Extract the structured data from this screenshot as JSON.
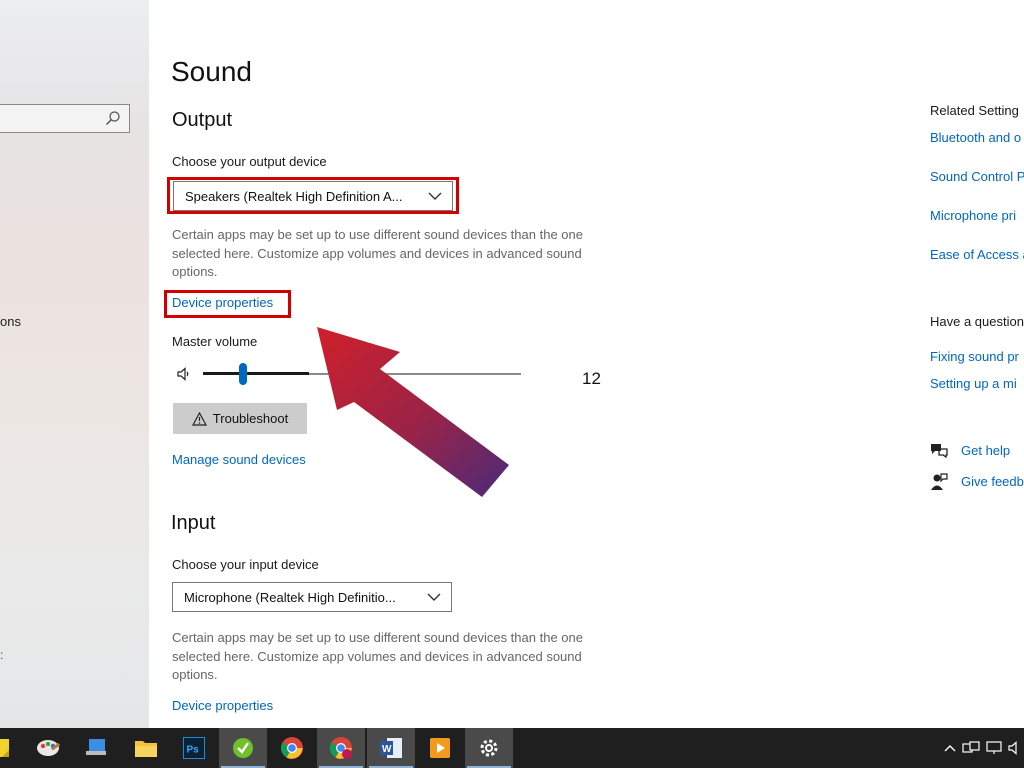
{
  "sidebar": {
    "fragment_1": "ons",
    "fragment_2": ":"
  },
  "page": {
    "title": "Sound"
  },
  "output": {
    "section_title": "Output",
    "device_label": "Choose your output device",
    "device_value": "Speakers (Realtek High Definition A...",
    "help_text": "Certain apps may be set up to use different sound devices than the one selected here. Customize app volumes and devices in advanced sound options.",
    "device_properties_link": "Device properties",
    "master_volume_label": "Master volume",
    "volume_value": "12",
    "volume_level": 12,
    "troubleshoot_label": "Troubleshoot",
    "manage_devices_link": "Manage sound devices"
  },
  "input": {
    "section_title": "Input",
    "device_label": "Choose your input device",
    "device_value": "Microphone (Realtek High Definitio...",
    "help_text": "Certain apps may be set up to use different sound devices than the one selected here. Customize app volumes and devices in advanced sound options.",
    "device_properties_link": "Device properties"
  },
  "related": {
    "heading": "Related Setting",
    "links": [
      "Bluetooth and o",
      "Sound Control P",
      "Microphone pri",
      "Ease of Access a"
    ],
    "question_heading": "Have a question",
    "question_links": [
      "Fixing sound pr",
      "Setting up a mi"
    ],
    "get_help": "Get help",
    "give_feedback": "Give feedba"
  },
  "annotation": {
    "highlight_color": "#d40000",
    "arrow_colors": [
      "#d0202a",
      "#4a2a7a"
    ]
  },
  "colors": {
    "accent": "#0067c0",
    "taskbar": "#1f1f1f"
  },
  "taskbar": {
    "items": [
      "sticky-notes-icon",
      "paint-icon",
      "pc-icon",
      "file-explorer-icon",
      "photoshop-icon",
      "greenshot-icon",
      "chrome-icon",
      "chrome-profile-icon",
      "word-icon",
      "media-player-icon",
      "settings-icon"
    ]
  }
}
